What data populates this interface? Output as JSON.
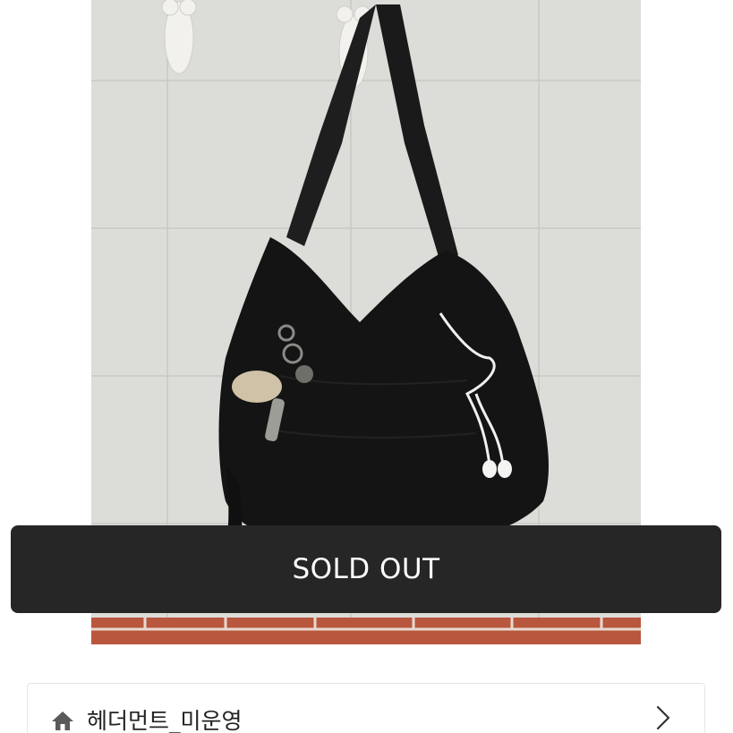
{
  "product": {
    "status_label": "SOLD OUT"
  },
  "shop": {
    "name": "헤더먼트_미운영",
    "icon": "home-icon",
    "chevron": "chevron-right-icon"
  },
  "colors": {
    "banner_bg": "#262626",
    "banner_text": "#ffffff",
    "text_primary": "#222222",
    "border": "#e6e6e6"
  }
}
